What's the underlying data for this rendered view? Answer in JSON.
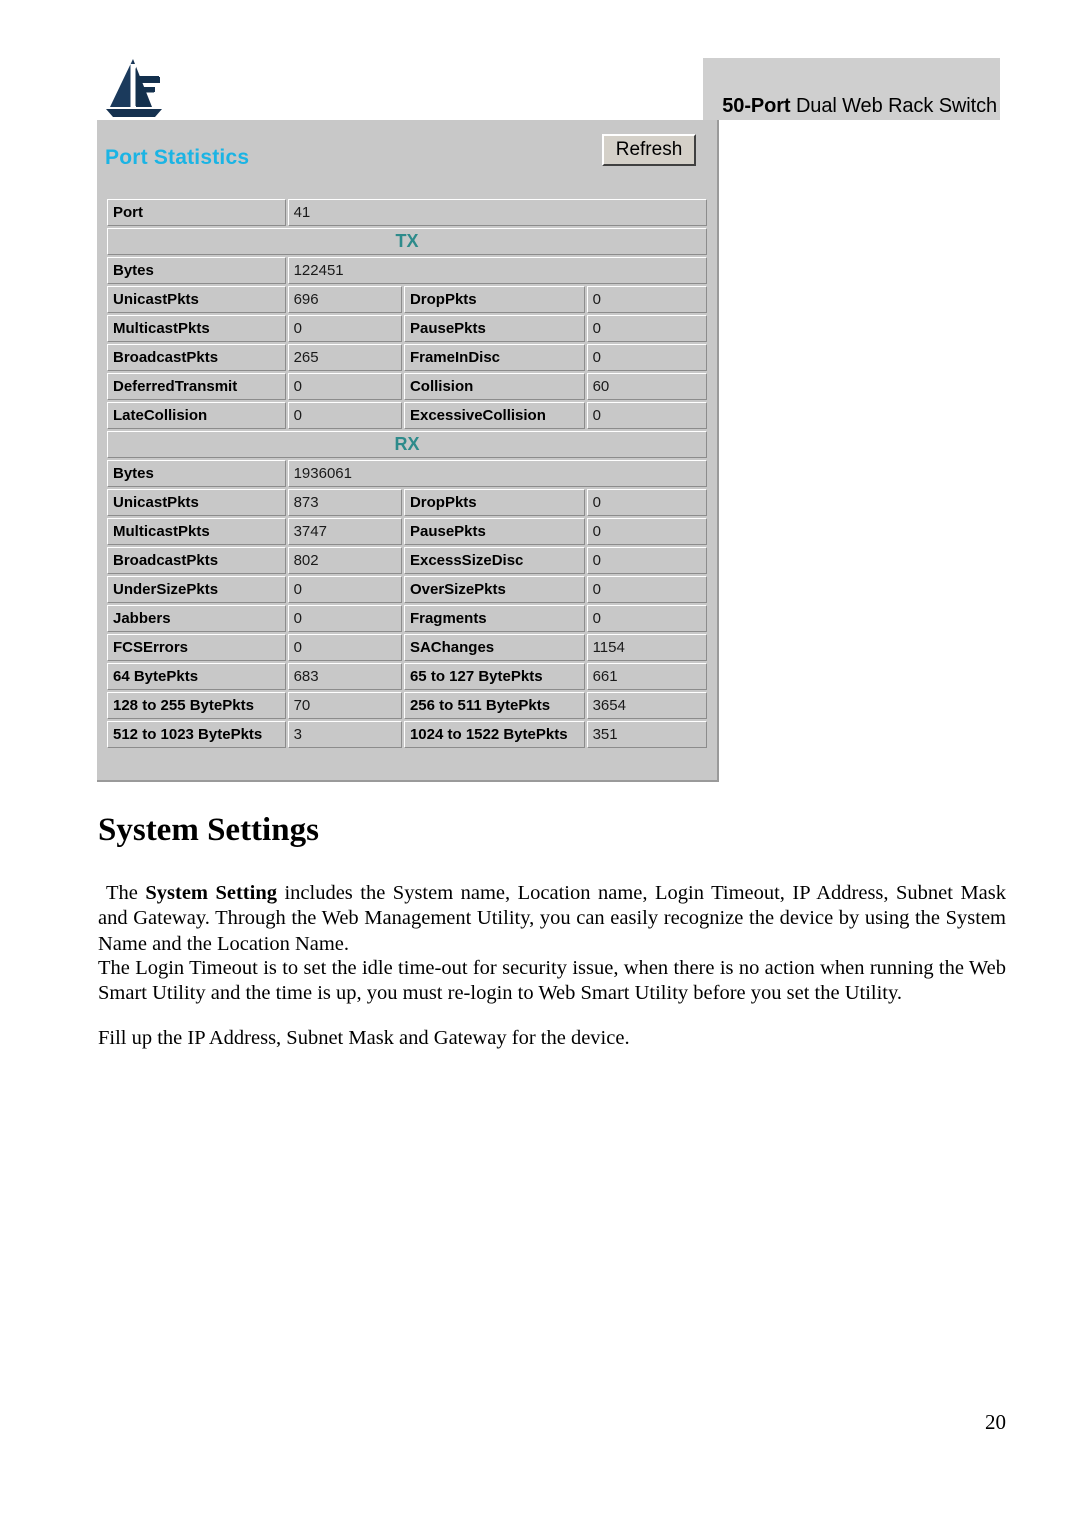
{
  "header": {
    "logo_name": "atlantis-land-logo",
    "product_banner": "50-Port Dual Web Rack Switch",
    "banner_prefix": "50-Port",
    "banner_rest": " Dual Web Rack Switch"
  },
  "panel": {
    "title": "Port Statistics",
    "refresh_label": "Refresh",
    "title_color": "#1BB4E4",
    "section_color": "#2E8B8B",
    "panel_bg": "#c8c8c8"
  },
  "port": {
    "label": "Port",
    "value": "41"
  },
  "tx": {
    "section_label": "TX",
    "bytes_label": "Bytes",
    "bytes_value": "122451",
    "rows": [
      {
        "label": "UnicastPkts",
        "value": "696",
        "label2": "DropPkts",
        "value2": "0"
      },
      {
        "label": "MulticastPkts",
        "value": "0",
        "label2": "PausePkts",
        "value2": "0"
      },
      {
        "label": "BroadcastPkts",
        "value": "265",
        "label2": "FrameInDisc",
        "value2": "0"
      },
      {
        "label": "DeferredTransmit",
        "value": "0",
        "label2": "Collision",
        "value2": "60"
      },
      {
        "label": "LateCollision",
        "value": "0",
        "label2": "ExcessiveCollision",
        "value2": "0"
      }
    ]
  },
  "rx": {
    "section_label": "RX",
    "bytes_label": "Bytes",
    "bytes_value": "1936061",
    "rows": [
      {
        "label": "UnicastPkts",
        "value": "873",
        "label2": "DropPkts",
        "value2": "0"
      },
      {
        "label": "MulticastPkts",
        "value": "3747",
        "label2": "PausePkts",
        "value2": "0"
      },
      {
        "label": "BroadcastPkts",
        "value": "802",
        "label2": "ExcessSizeDisc",
        "value2": "0"
      },
      {
        "label": "UnderSizePkts",
        "value": "0",
        "label2": "OverSizePkts",
        "value2": "0"
      },
      {
        "label": "Jabbers",
        "value": "0",
        "label2": "Fragments",
        "value2": "0"
      },
      {
        "label": "FCSErrors",
        "value": "0",
        "label2": "SAChanges",
        "value2": "1154"
      },
      {
        "label": "64 BytePkts",
        "value": "683",
        "label2": "65 to 127 BytePkts",
        "value2": "661"
      },
      {
        "label": "128 to 255 BytePkts",
        "value": "70",
        "label2": "256 to 511 BytePkts",
        "value2": "3654"
      },
      {
        "label": "512 to 1023 BytePkts",
        "value": "3",
        "label2": "1024 to 1522 BytePkts",
        "value2": "351"
      }
    ]
  },
  "document": {
    "heading": "System Settings",
    "para1_lead": "The ",
    "para1_bold": "System Setting",
    "para1_rest": " includes the System name, Location name, Login Timeout, IP Address, Subnet Mask and Gateway. Through the Web Management Utility, you can easily recognize the device by using the System Name and the Location Name.",
    "para2": "The Login Timeout is to set the idle time-out for security issue, when there is no action when running the Web Smart Utility and the time is up, you must re-login to Web Smart Utility before you set the Utility.",
    "para3": "Fill up the IP Address, Subnet Mask and Gateway for the device.",
    "page_number": "20"
  }
}
